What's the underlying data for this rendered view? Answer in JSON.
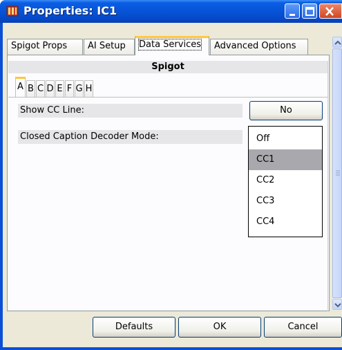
{
  "window": {
    "title": "Properties: IC1"
  },
  "tabs": [
    "Spigot Props",
    "AI Setup",
    "Data Services",
    "Advanced Options"
  ],
  "active_tab": "Data Services",
  "section": {
    "title": "Spigot"
  },
  "inner_tabs": [
    "A",
    "B",
    "C",
    "D",
    "E",
    "F",
    "G",
    "H"
  ],
  "active_inner_tab": "A",
  "fields": {
    "show_cc_line": {
      "label": "Show CC Line:",
      "value": "No"
    },
    "decoder_mode": {
      "label": "Closed Caption Decoder Mode:"
    }
  },
  "dropdown": {
    "options": [
      "Off",
      "CC1",
      "CC2",
      "CC3",
      "CC4"
    ],
    "selected": "CC1"
  },
  "buttons": {
    "defaults": "Defaults",
    "ok": "OK",
    "cancel": "Cancel"
  },
  "colors": {
    "titlebar": "#0653d6",
    "tab_highlight": "#ffc83c",
    "dialog_bg": "#ece9d8",
    "selected_option": "#a9a9ad"
  }
}
